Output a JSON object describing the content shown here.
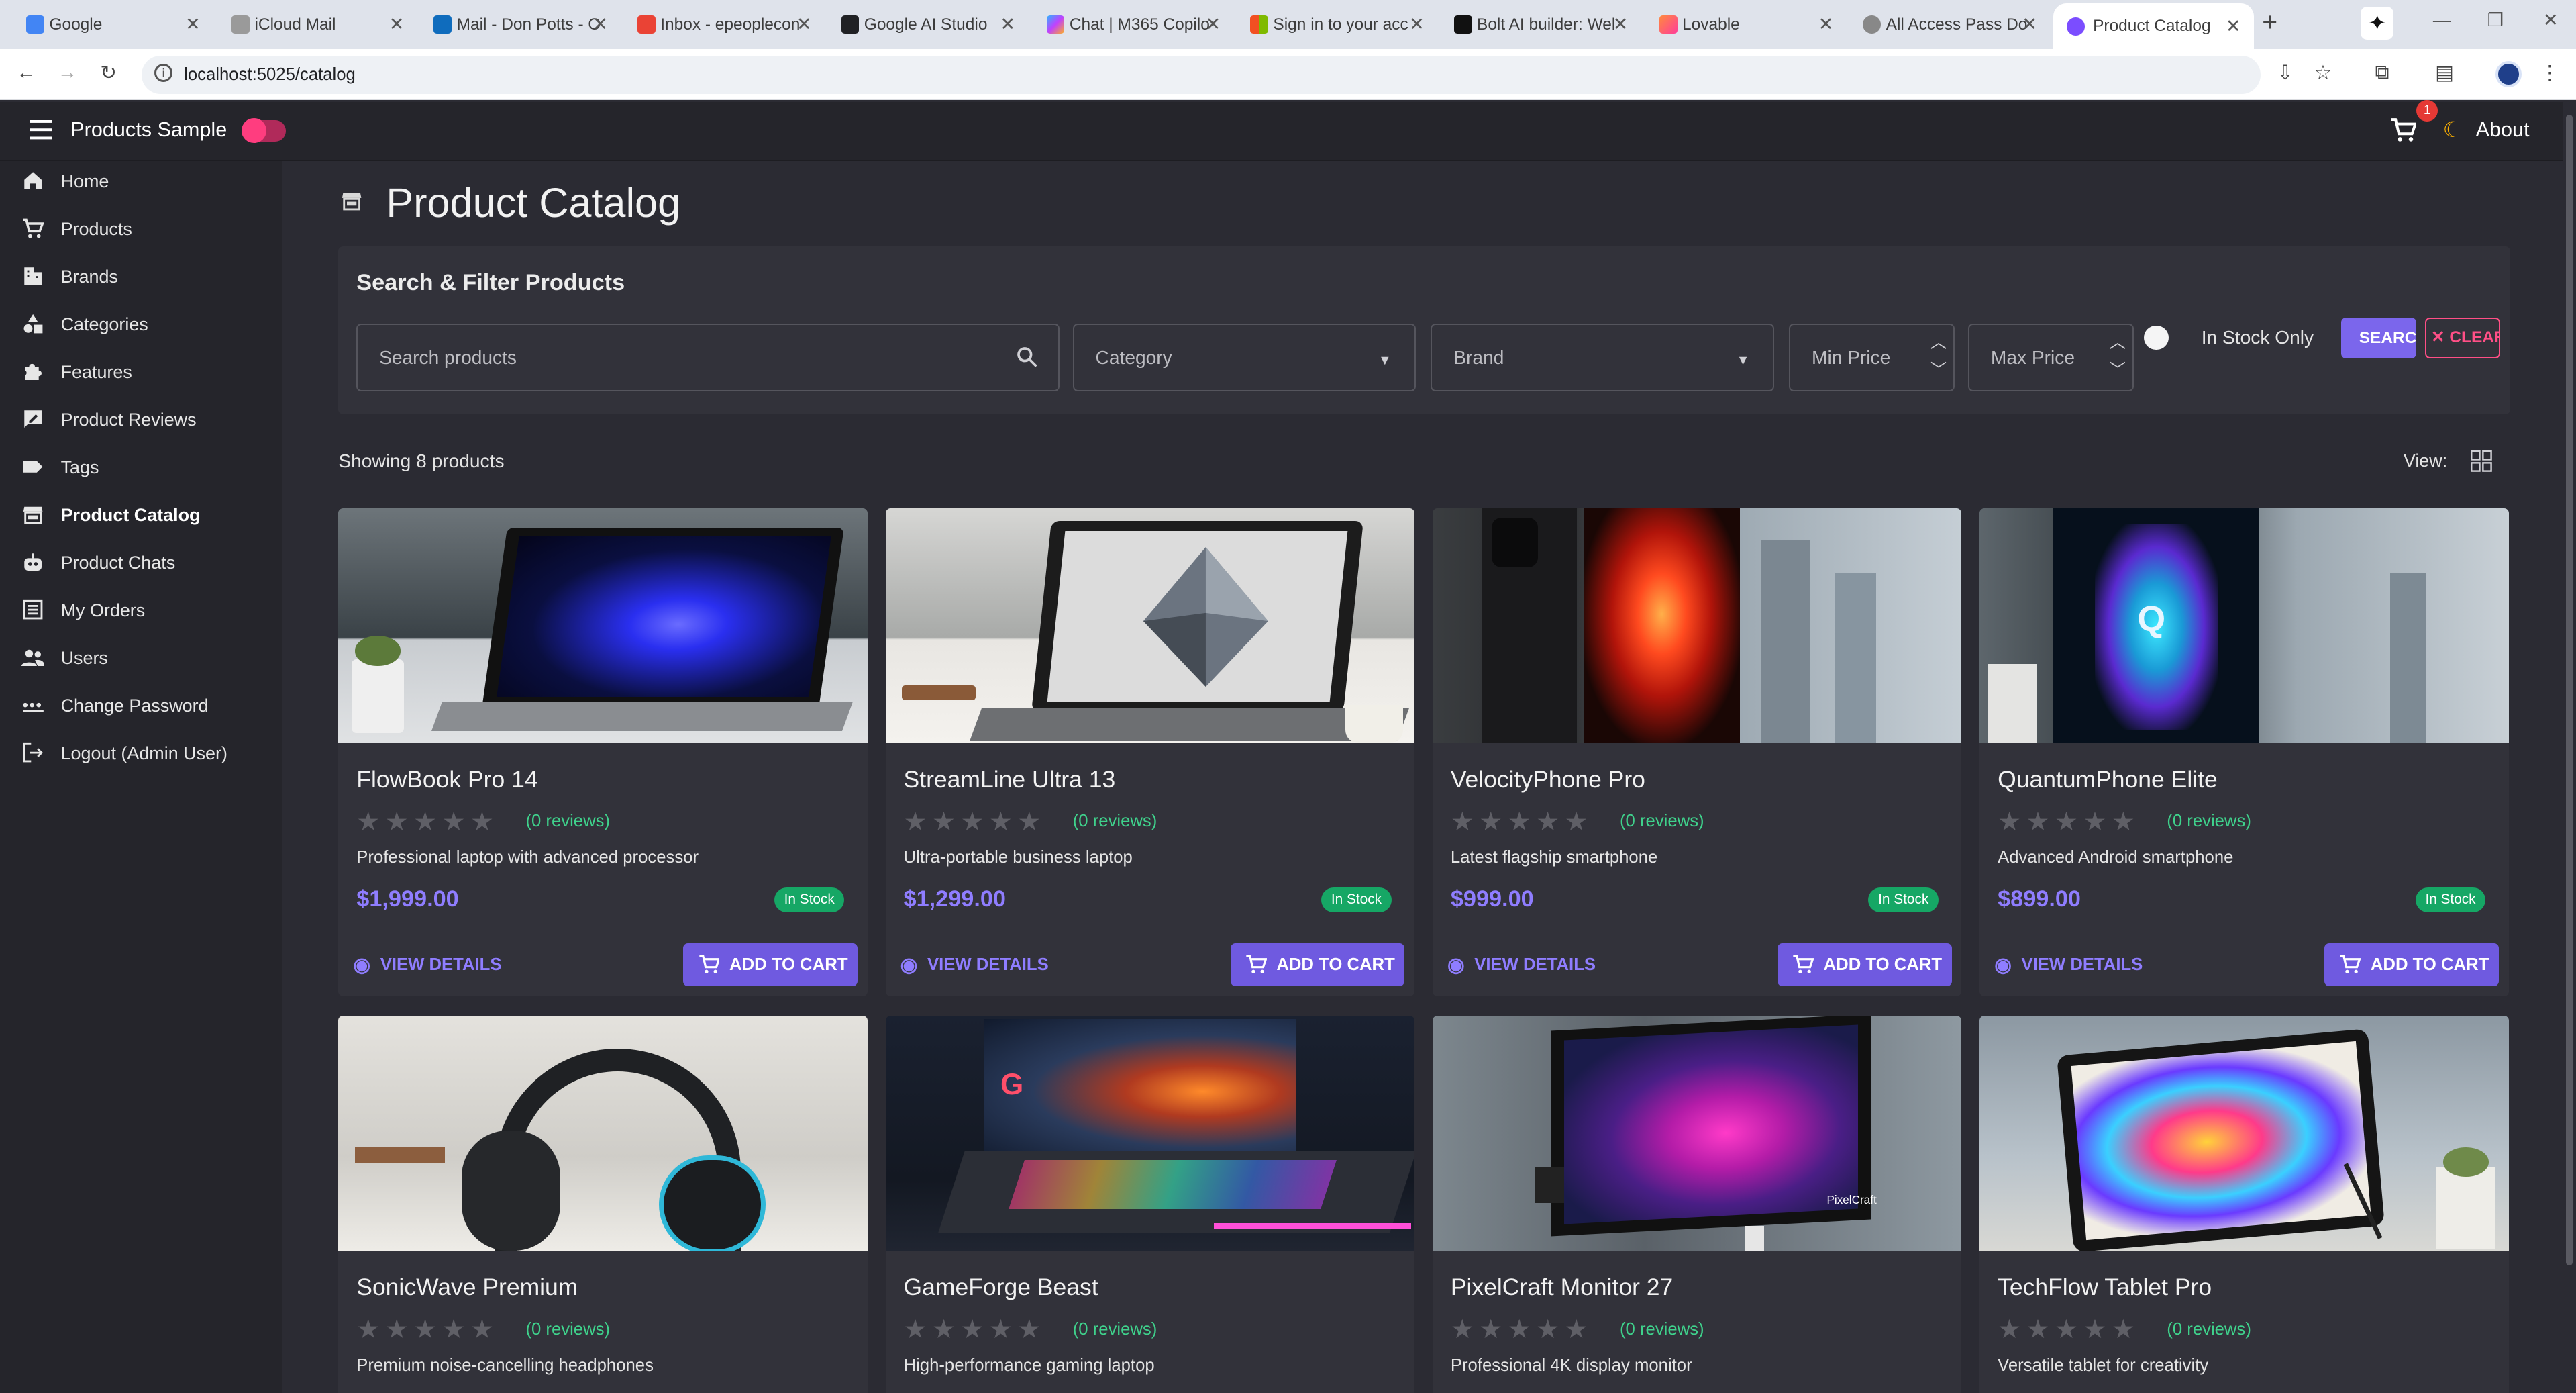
{
  "browser": {
    "tabs": [
      {
        "title": "Google",
        "color": "#4285f4"
      },
      {
        "title": "iCloud Mail",
        "color": "#888888"
      },
      {
        "title": "Mail - Don Potts - O",
        "color": "#0f6cbd"
      },
      {
        "title": "Inbox - epeoplecon",
        "color": "#ea4335"
      },
      {
        "title": "Google AI Studio",
        "color": "#202124"
      },
      {
        "title": "Chat | M365 Copilo",
        "color": "#7c5cff"
      },
      {
        "title": "Sign in to your acc",
        "color": "#f25022"
      },
      {
        "title": "Bolt AI builder: Wel",
        "color": "#111111"
      },
      {
        "title": "Lovable",
        "color": "#ff5a6e"
      },
      {
        "title": "All Access Pass Do",
        "color": "#777777"
      },
      {
        "title": "Product Catalog",
        "color": "#7b4dff"
      }
    ],
    "url": "localhost:5025/catalog"
  },
  "app": {
    "title": "Products Sample",
    "about_label": "About",
    "cart_badge": "1",
    "accent": "#6f5ae0",
    "toggle_color": "#ff3d7f"
  },
  "sidebar": {
    "items": [
      {
        "label": "Home",
        "icon": "home-icon"
      },
      {
        "label": "Products",
        "icon": "cart-icon"
      },
      {
        "label": "Brands",
        "icon": "building-icon"
      },
      {
        "label": "Categories",
        "icon": "shapes-icon"
      },
      {
        "label": "Features",
        "icon": "puzzle-icon"
      },
      {
        "label": "Product Reviews",
        "icon": "rate-review-icon"
      },
      {
        "label": "Tags",
        "icon": "tag-icon"
      },
      {
        "label": "Product Catalog",
        "icon": "storefront-icon"
      },
      {
        "label": "Product Chats",
        "icon": "robot-icon"
      },
      {
        "label": "My Orders",
        "icon": "list-icon"
      },
      {
        "label": "Users",
        "icon": "people-icon"
      },
      {
        "label": "Change Password",
        "icon": "password-icon"
      },
      {
        "label": "Logout (Admin User)",
        "icon": "logout-icon"
      }
    ]
  },
  "page": {
    "title": "Product Catalog",
    "filter_title": "Search & Filter Products",
    "search_placeholder": "Search products",
    "category_placeholder": "Category",
    "brand_placeholder": "Brand",
    "min_price_placeholder": "Min Price",
    "max_price_placeholder": "Max Price",
    "in_stock_label": "In Stock Only",
    "search_btn": "SEARCH",
    "clear_btn": "CLEAR",
    "showing": "Showing 8 products",
    "view_label": "View:"
  },
  "products": [
    {
      "name": "FlowBook Pro 14",
      "reviews": "(0 reviews)",
      "desc": "Professional laptop with advanced processor",
      "price": "$1,999.00",
      "stock": "In Stock",
      "view": "VIEW DETAILS",
      "cart": "ADD TO CART",
      "rating": 0
    },
    {
      "name": "StreamLine Ultra 13",
      "reviews": "(0 reviews)",
      "desc": "Ultra-portable business laptop",
      "price": "$1,299.00",
      "stock": "In Stock",
      "view": "VIEW DETAILS",
      "cart": "ADD TO CART",
      "rating": 0
    },
    {
      "name": "VelocityPhone Pro",
      "reviews": "(0 reviews)",
      "desc": "Latest flagship smartphone",
      "price": "$999.00",
      "stock": "In Stock",
      "view": "VIEW DETAILS",
      "cart": "ADD TO CART",
      "rating": 0
    },
    {
      "name": "QuantumPhone Elite",
      "reviews": "(0 reviews)",
      "desc": "Advanced Android smartphone",
      "price": "$899.00",
      "stock": "In Stock",
      "view": "VIEW DETAILS",
      "cart": "ADD TO CART",
      "rating": 0
    },
    {
      "name": "SonicWave Premium",
      "reviews": "(0 reviews)",
      "desc": "Premium noise-cancelling headphones",
      "price": "",
      "stock": "",
      "view": "",
      "cart": "",
      "rating": 0
    },
    {
      "name": "GameForge Beast",
      "reviews": "(0 reviews)",
      "desc": "High-performance gaming laptop",
      "price": "",
      "stock": "",
      "view": "",
      "cart": "",
      "rating": 0
    },
    {
      "name": "PixelCraft Monitor 27",
      "reviews": "(0 reviews)",
      "desc": "Professional 4K display monitor",
      "price": "",
      "stock": "",
      "view": "",
      "cart": "",
      "rating": 0
    },
    {
      "name": "TechFlow Tablet Pro",
      "reviews": "(0 reviews)",
      "desc": "Versatile tablet for creativity",
      "price": "",
      "stock": "",
      "view": "",
      "cart": "",
      "rating": 0
    }
  ]
}
